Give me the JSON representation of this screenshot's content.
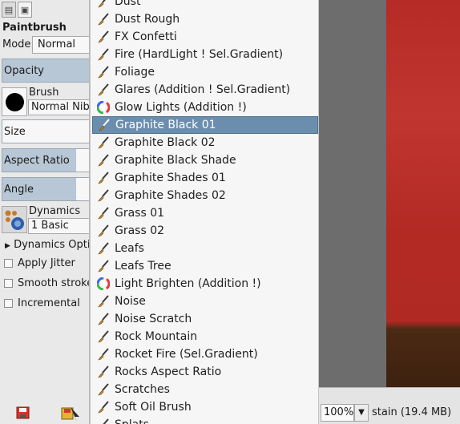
{
  "tool_options": {
    "title": "Paintbrush",
    "mode_label": "Mode:",
    "mode_value": "Normal",
    "opacity_label": "Opacity",
    "brush_label": "Brush",
    "brush_value": "Normal Nib",
    "size_label": "Size",
    "aspect_ratio_label": "Aspect Ratio",
    "angle_label": "Angle",
    "dynamics_label": "Dynamics",
    "dynamics_value": "1 Basic",
    "dynamics_options_label": "Dynamics Optic",
    "apply_jitter_label": "Apply Jitter",
    "smooth_stroke_label": "Smooth stroke",
    "incremental_label": "Incremental"
  },
  "brush_menu": {
    "items": [
      {
        "label": "Dust",
        "icon": "brush-icon"
      },
      {
        "label": "Dust Rough",
        "icon": "brush-icon"
      },
      {
        "label": "FX Confetti",
        "icon": "brush-icon"
      },
      {
        "label": "Fire (HardLight ! Sel.Gradient)",
        "icon": "brush-icon"
      },
      {
        "label": "Foliage",
        "icon": "brush-icon"
      },
      {
        "label": "Glares (Addition ! Sel.Gradient)",
        "icon": "brush-icon"
      },
      {
        "label": "Glow Lights (Addition !)",
        "icon": "color-wheel-icon"
      },
      {
        "label": "Graphite Black 01",
        "icon": "brush-icon",
        "selected": true
      },
      {
        "label": "Graphite Black 02",
        "icon": "brush-icon"
      },
      {
        "label": "Graphite Black Shade",
        "icon": "brush-icon"
      },
      {
        "label": "Graphite Shades 01",
        "icon": "brush-icon"
      },
      {
        "label": "Graphite Shades 02",
        "icon": "brush-icon"
      },
      {
        "label": "Grass 01",
        "icon": "brush-icon"
      },
      {
        "label": "Grass 02",
        "icon": "brush-icon"
      },
      {
        "label": "Leafs",
        "icon": "brush-icon"
      },
      {
        "label": "Leafs Tree",
        "icon": "brush-icon"
      },
      {
        "label": "Light Brighten (Addition !)",
        "icon": "color-wheel-icon"
      },
      {
        "label": "Noise",
        "icon": "brush-icon"
      },
      {
        "label": "Noise Scratch",
        "icon": "brush-icon"
      },
      {
        "label": "Rock  Mountain",
        "icon": "brush-icon"
      },
      {
        "label": "Rocket Fire (Sel.Gradient)",
        "icon": "brush-icon"
      },
      {
        "label": "Rocks Aspect Ratio",
        "icon": "brush-icon"
      },
      {
        "label": "Scratches",
        "icon": "brush-icon"
      },
      {
        "label": "Soft Oil Brush",
        "icon": "brush-icon"
      },
      {
        "label": "Splats",
        "icon": "brush-icon"
      }
    ]
  },
  "status": {
    "zoom": "100%",
    "info": "stain (19.4 MB)"
  },
  "colors": {
    "selection": "#6b8eaf",
    "canvas_red": "#b72b27"
  }
}
